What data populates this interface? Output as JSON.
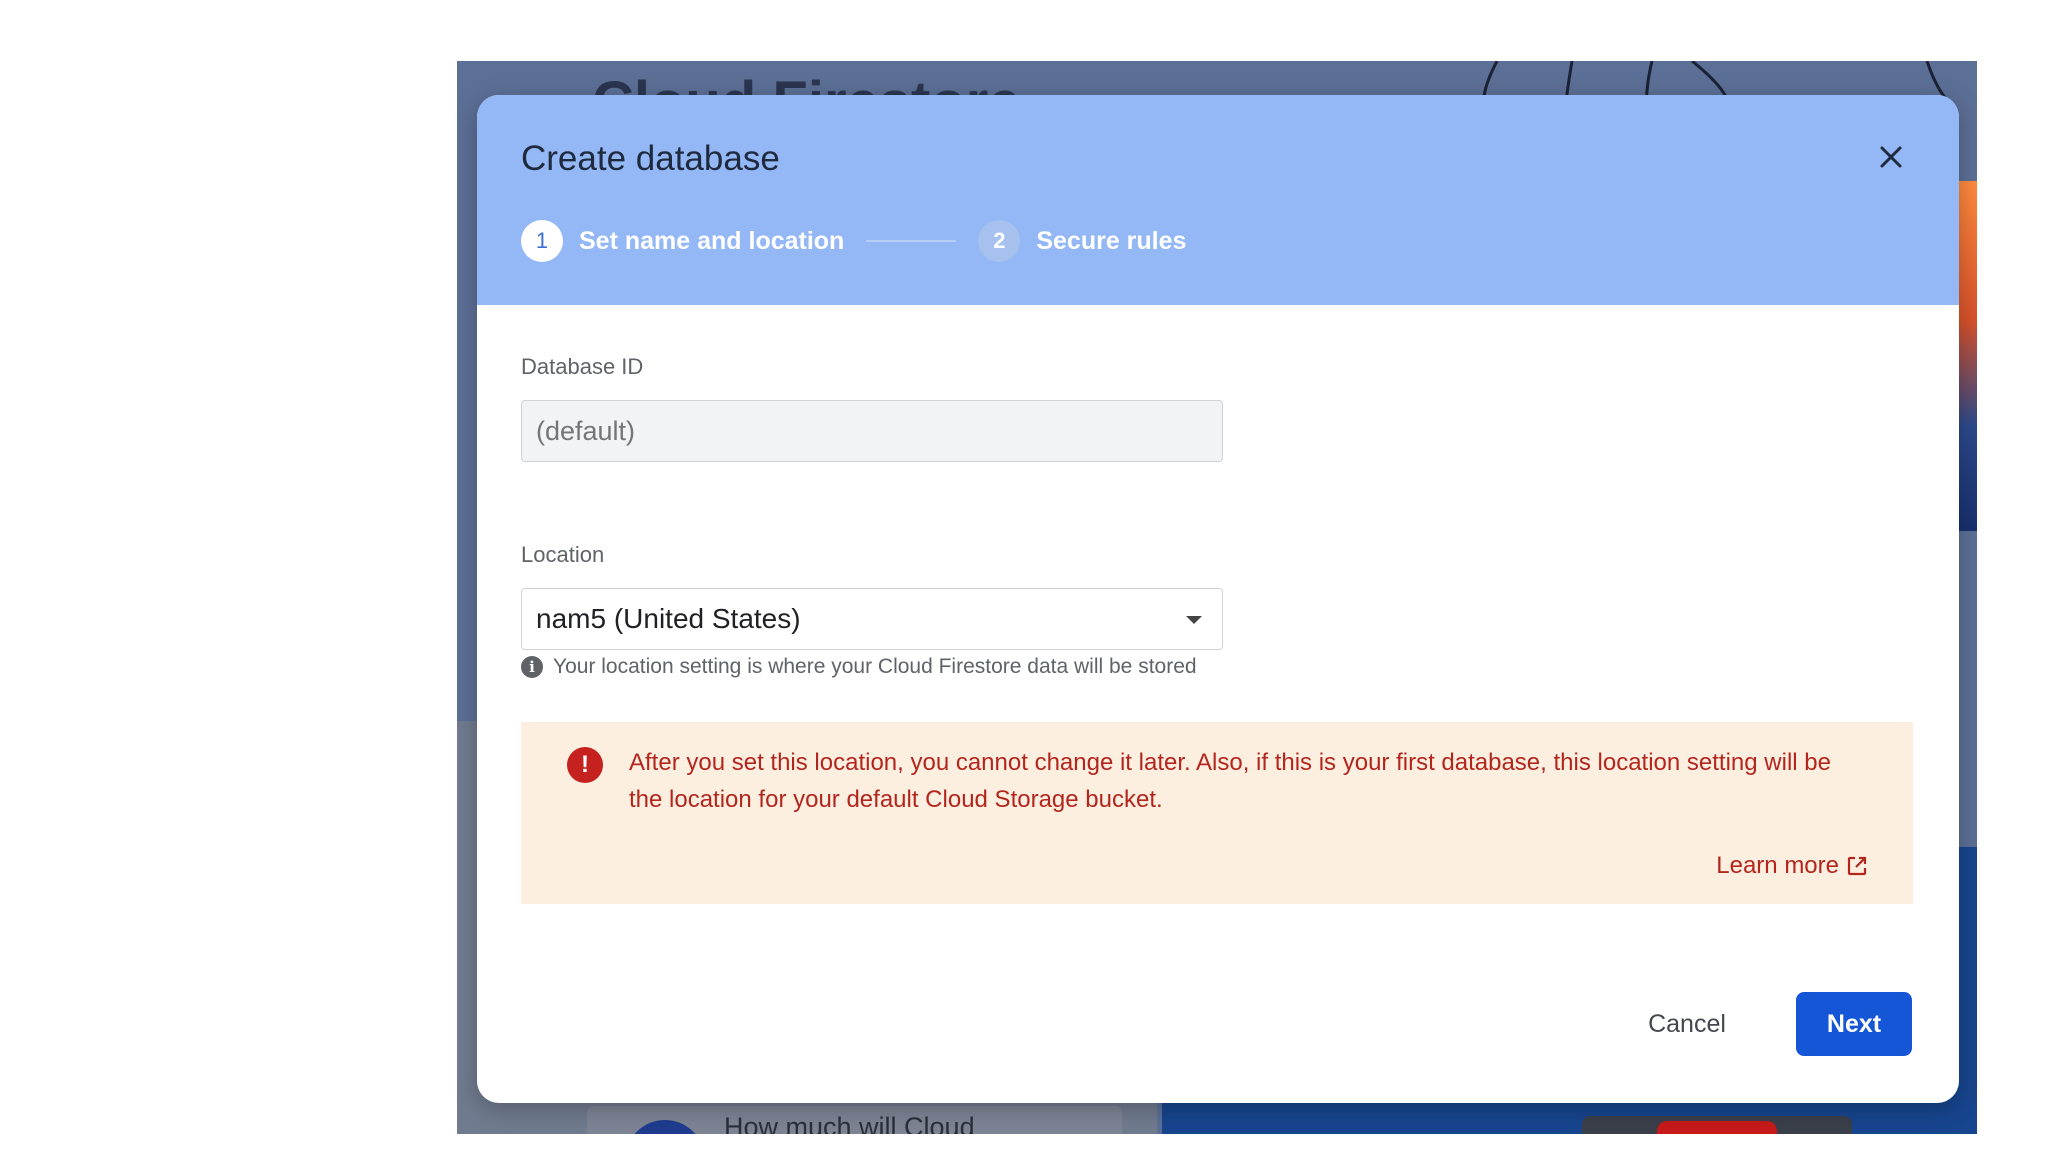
{
  "background": {
    "page_title": "Cloud Firestore",
    "card_text": "How much will Cloud"
  },
  "dialog": {
    "title": "Create database",
    "close_icon": "close-icon",
    "steps": [
      {
        "number": "1",
        "label": "Set name and location",
        "active": true
      },
      {
        "number": "2",
        "label": "Secure rules",
        "active": false
      }
    ],
    "database_id": {
      "label": "Database ID",
      "placeholder": "(default)",
      "value": ""
    },
    "location": {
      "label": "Location",
      "selected": "nam5 (United States)",
      "hint": "Your location setting is where your Cloud Firestore data will be stored",
      "hint_icon": "info-icon"
    },
    "warning": {
      "icon": "error-icon",
      "text": "After you set this location, you cannot change it later. Also, if this is your first database, this location setting will be the location for your default Cloud Storage bucket.",
      "link": "Learn more",
      "link_icon": "external-link-icon"
    },
    "actions": {
      "cancel": "Cancel",
      "next": "Next"
    }
  },
  "colors": {
    "header_bg": "#93b8f5",
    "primary": "#1556d6",
    "warning_bg": "#fdefe0",
    "warning_text": "#b3261e"
  }
}
